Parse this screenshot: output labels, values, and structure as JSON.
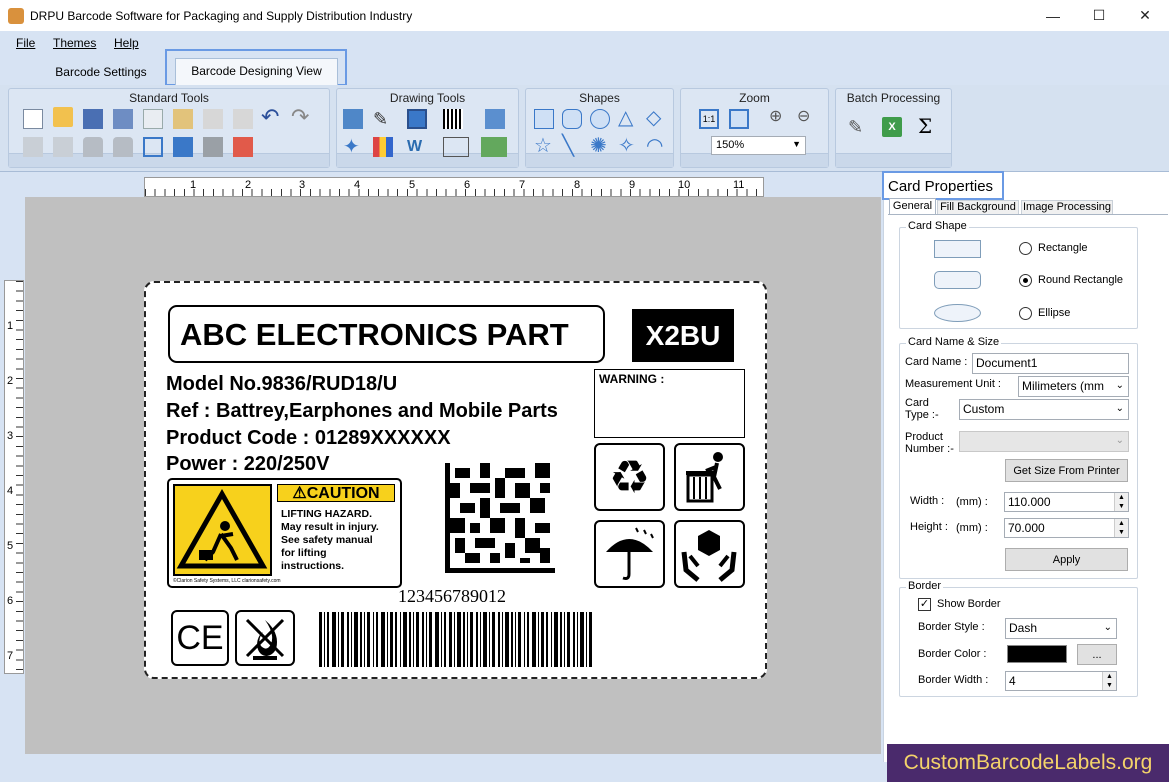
{
  "window": {
    "title": "DRPU Barcode Software for Packaging and Supply Distribution Industry",
    "minimize": "—",
    "maximize": "☐",
    "close": "✕"
  },
  "menu": [
    "File",
    "Themes",
    "Help"
  ],
  "tabs": [
    "Barcode Settings",
    "Barcode Designing View"
  ],
  "ribbon": {
    "groups": [
      "Standard Tools",
      "Drawing Tools",
      "Shapes",
      "Zoom",
      "Batch Processing"
    ],
    "zoom_value": "150%"
  },
  "rulers": {
    "horizontal": [
      "1",
      "2",
      "3",
      "4",
      "5",
      "6",
      "7",
      "8",
      "9",
      "10",
      "11"
    ],
    "vertical": [
      "1",
      "2",
      "3",
      "4",
      "5",
      "6",
      "7"
    ]
  },
  "label": {
    "header": "ABC ELECTRONICS PART",
    "code_badge": "X2BU",
    "line1": "Model No.9836/RUD18/U",
    "line2": "Ref : Battrey,Earphones and Mobile Parts",
    "line3": "Product Code : 01289XXXXXX",
    "line4": "Power : 220/250V",
    "warning_title": "WARNING :",
    "caution": {
      "title": "⚠CAUTION",
      "body": [
        "LIFTING HAZARD.",
        "May result in injury.",
        "See safety manual",
        "for lifting",
        "instructions."
      ],
      "footer": "©Clarion Safety Systems, LLC      clarionsafety.com"
    },
    "barcode_number": "123456789012",
    "ce_mark": "CE"
  },
  "panel": {
    "title": "Card Properties",
    "tabs": [
      "General",
      "Fill Background",
      "Image Processing"
    ],
    "card_shape": {
      "title": "Card Shape",
      "options": [
        "Rectangle",
        "Round Rectangle",
        "Ellipse"
      ],
      "selected": "Round Rectangle"
    },
    "card_name_size": {
      "title": "Card  Name & Size",
      "card_name_label": "Card Name :",
      "card_name_value": "Document1",
      "unit_label": "Measurement Unit :",
      "unit_value": "Milimeters (mm",
      "card_type_label": "Card\nType :-",
      "card_type_label_line1": "Card",
      "card_type_label_line2": "Type :-",
      "card_type_value": "Custom",
      "product_number_label_line1": "Product",
      "product_number_label_line2": "Number :-",
      "get_size_button": "Get Size From Printer",
      "width_label": "Width :",
      "width_unit": "(mm) :",
      "width_value": "110.000",
      "height_label": "Height :",
      "height_unit": "(mm) :",
      "height_value": "70.000",
      "apply_button": "Apply"
    },
    "border": {
      "title": "Border",
      "show_border_label": "Show Border",
      "show_border_checked": true,
      "style_label": "Border Style :",
      "style_value": "Dash",
      "color_label": "Border Color :",
      "color_value": "#000000",
      "color_button": "...",
      "width_label": "Border Width :",
      "width_value": "4"
    }
  },
  "watermark": "CustomBarcodeLabels.org"
}
